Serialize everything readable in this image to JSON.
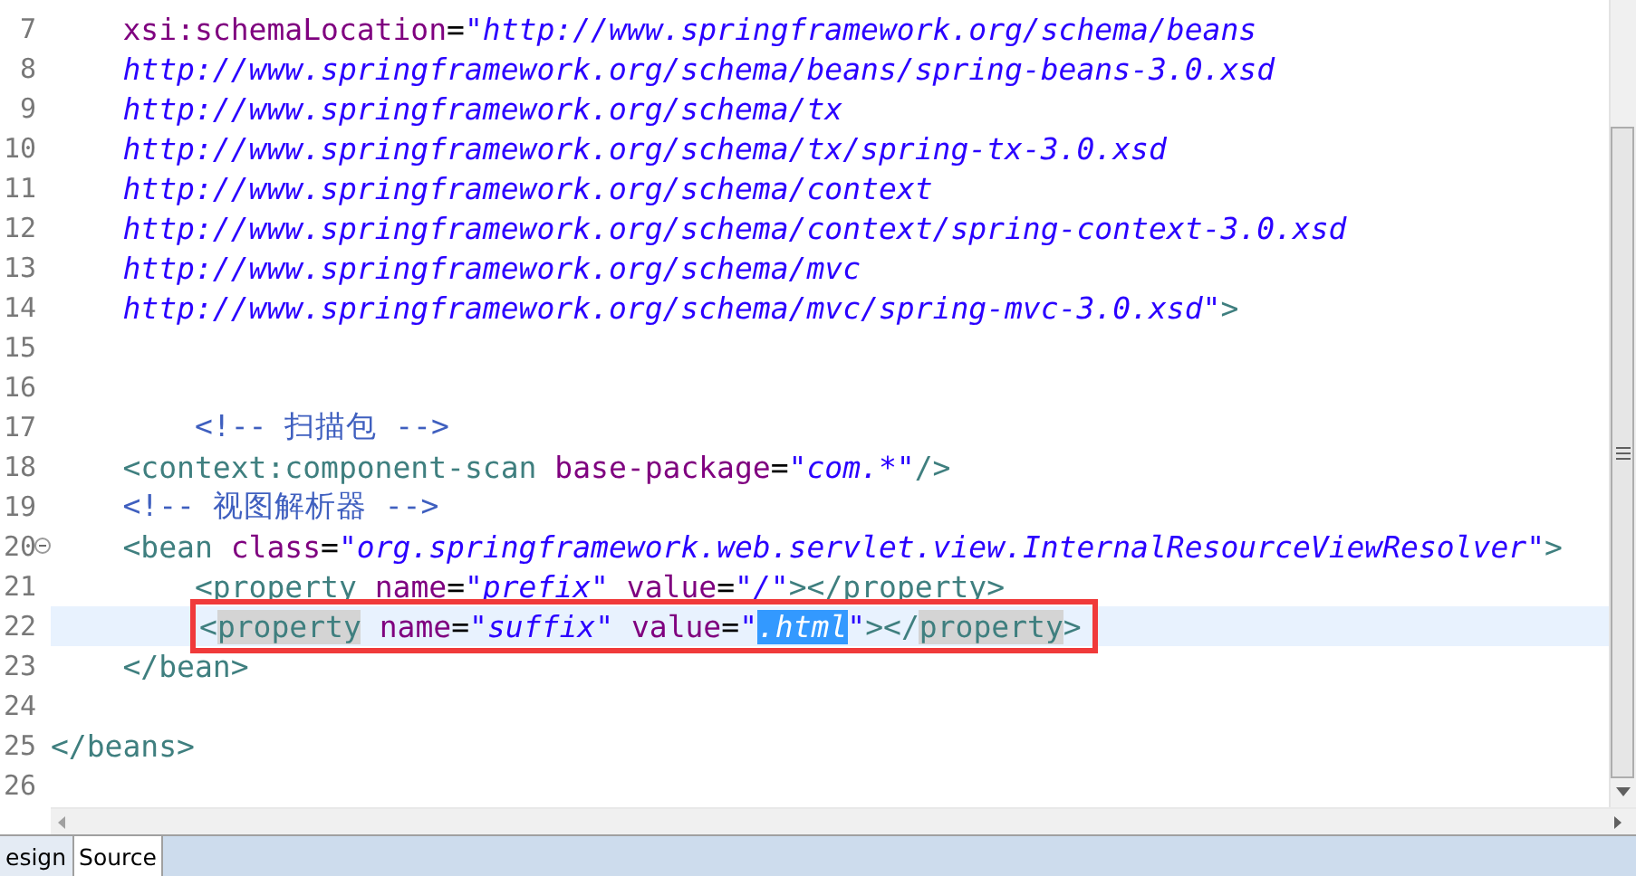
{
  "editor": {
    "lines": [
      {
        "number": "7",
        "current": false,
        "fold": false,
        "tokens": [
          {
            "kind": "attr",
            "text": "    xsi:schemaLocation"
          },
          {
            "kind": "plain",
            "text": "="
          },
          {
            "kind": "value",
            "text": "\"http://www.springframework.org/schema/beans"
          }
        ]
      },
      {
        "number": "8",
        "current": false,
        "fold": false,
        "tokens": [
          {
            "kind": "value",
            "text": "    http://www.springframework.org/schema/beans/spring-beans-3.0.xsd"
          }
        ]
      },
      {
        "number": "9",
        "current": false,
        "fold": false,
        "tokens": [
          {
            "kind": "value",
            "text": "    http://www.springframework.org/schema/tx"
          }
        ]
      },
      {
        "number": "10",
        "current": false,
        "fold": false,
        "tokens": [
          {
            "kind": "value",
            "text": "    http://www.springframework.org/schema/tx/spring-tx-3.0.xsd"
          }
        ]
      },
      {
        "number": "11",
        "current": false,
        "fold": false,
        "tokens": [
          {
            "kind": "value",
            "text": "    http://www.springframework.org/schema/context"
          }
        ]
      },
      {
        "number": "12",
        "current": false,
        "fold": false,
        "tokens": [
          {
            "kind": "value",
            "text": "    http://www.springframework.org/schema/context/spring-context-3.0.xsd"
          }
        ]
      },
      {
        "number": "13",
        "current": false,
        "fold": false,
        "tokens": [
          {
            "kind": "value",
            "text": "    http://www.springframework.org/schema/mvc"
          }
        ]
      },
      {
        "number": "14",
        "current": false,
        "fold": false,
        "tokens": [
          {
            "kind": "value",
            "text": "    http://www.springframework.org/schema/mvc/spring-mvc-3.0.xsd\""
          },
          {
            "kind": "tag",
            "text": ">"
          }
        ]
      },
      {
        "number": "15",
        "current": false,
        "fold": false
      },
      {
        "number": "16",
        "current": false,
        "fold": false
      },
      {
        "number": "17",
        "current": false,
        "fold": false,
        "tokens": [
          {
            "kind": "comment",
            "text": "        <!-- 扫描包 -->"
          }
        ]
      },
      {
        "number": "18",
        "current": false,
        "fold": false,
        "tokens": [
          {
            "kind": "tag",
            "text": "    <context:component-scan"
          },
          {
            "kind": "attr",
            "text": " base-package"
          },
          {
            "kind": "plain",
            "text": "="
          },
          {
            "kind": "value",
            "text": "\"com.*\""
          },
          {
            "kind": "tag",
            "text": "/>"
          }
        ]
      },
      {
        "number": "19",
        "current": false,
        "fold": false,
        "tokens": [
          {
            "kind": "comment",
            "text": "    <!-- 视图解析器 -->"
          }
        ]
      },
      {
        "number": "20",
        "current": false,
        "fold": true,
        "tokens": [
          {
            "kind": "tag",
            "text": "    <bean"
          },
          {
            "kind": "attr",
            "text": " class"
          },
          {
            "kind": "plain",
            "text": "="
          },
          {
            "kind": "value",
            "text": "\"org.springframework.web.servlet.view.InternalResourceViewResolver\""
          },
          {
            "kind": "tag",
            "text": ">"
          }
        ]
      },
      {
        "number": "21",
        "current": false,
        "fold": false,
        "tokens": [
          {
            "kind": "tag",
            "text": "        <property"
          },
          {
            "kind": "attr",
            "text": " name"
          },
          {
            "kind": "plain",
            "text": "="
          },
          {
            "kind": "value",
            "text": "\"prefix\""
          },
          {
            "kind": "attr",
            "text": " value"
          },
          {
            "kind": "plain",
            "text": "="
          },
          {
            "kind": "value",
            "text": "\"/\""
          },
          {
            "kind": "tag",
            "text": "></property>"
          }
        ]
      },
      {
        "number": "22",
        "current": true,
        "fold": false,
        "annotated": true,
        "tokens": [
          {
            "kind": "tag",
            "text": "<"
          },
          {
            "kind": "tag",
            "text": "property",
            "marked": true
          },
          {
            "kind": "attr",
            "text": " name"
          },
          {
            "kind": "plain",
            "text": "="
          },
          {
            "kind": "value",
            "text": "\"suffix\""
          },
          {
            "kind": "attr",
            "text": " value"
          },
          {
            "kind": "plain",
            "text": "="
          },
          {
            "kind": "value",
            "text": "\""
          },
          {
            "kind": "value",
            "text": ".html",
            "selected": true
          },
          {
            "kind": "value",
            "text": "\""
          },
          {
            "kind": "tag",
            "text": "></"
          },
          {
            "kind": "tag",
            "text": "property",
            "marked": true
          },
          {
            "kind": "tag",
            "text": ">"
          }
        ]
      },
      {
        "number": "23",
        "current": false,
        "fold": false,
        "tokens": [
          {
            "kind": "tag",
            "text": "    </bean>"
          }
        ]
      },
      {
        "number": "24",
        "current": false,
        "fold": false
      },
      {
        "number": "25",
        "current": false,
        "fold": false,
        "tokens": [
          {
            "kind": "tag",
            "text": "</beans>"
          }
        ]
      },
      {
        "number": "26",
        "current": false,
        "fold": false
      }
    ]
  },
  "tabs": [
    {
      "label": "esign",
      "selected": false
    },
    {
      "label": "Source",
      "selected": true
    }
  ]
}
